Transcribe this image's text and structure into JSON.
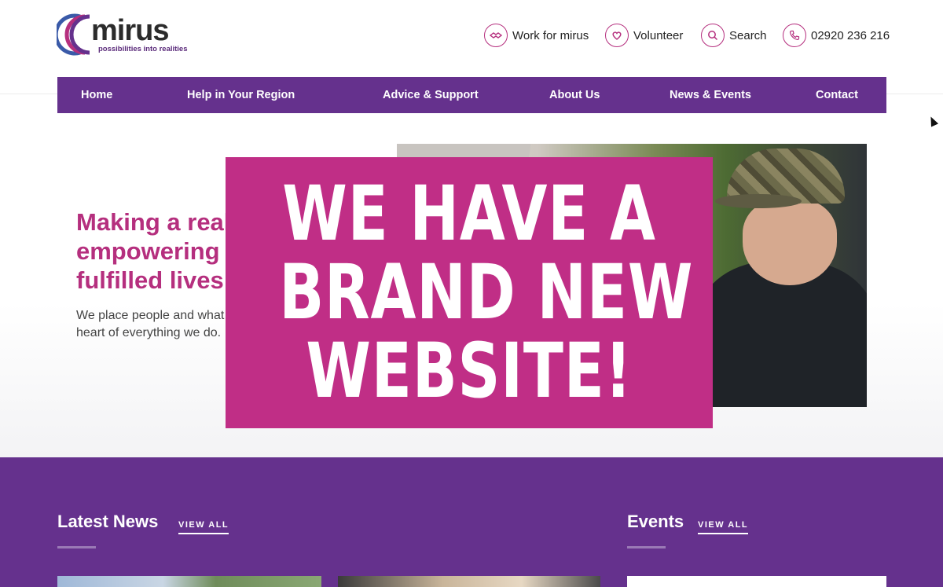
{
  "brand": {
    "logo_text": "mirus",
    "tagline": "possibilities into realities",
    "colors": {
      "purple": "#65318d",
      "magenta": "#b52f7e",
      "promo": "#c02e86"
    }
  },
  "utility": [
    {
      "label": "Work for mirus",
      "icon": "handshake-icon"
    },
    {
      "label": "Volunteer",
      "icon": "heart-hand-icon"
    },
    {
      "label": "Search",
      "icon": "search-icon"
    },
    {
      "label": "02920 236 216",
      "icon": "phone-icon"
    }
  ],
  "nav": {
    "items": [
      "Home",
      "Help in Your Region",
      "Advice & Support",
      "About Us",
      "News & Events",
      "Contact"
    ]
  },
  "hero": {
    "title_lines": [
      "Making a real",
      "empowering p",
      "fulfilled lives"
    ],
    "text_lines": [
      "We place people and what",
      "heart of everything we do."
    ]
  },
  "promo": {
    "lines": [
      "WE HAVE A",
      "BRAND NEW",
      "WEBSITE!"
    ]
  },
  "news": {
    "title": "Latest News",
    "view_all": "VIEW ALL"
  },
  "events": {
    "title": "Events",
    "view_all": "VIEW ALL"
  }
}
